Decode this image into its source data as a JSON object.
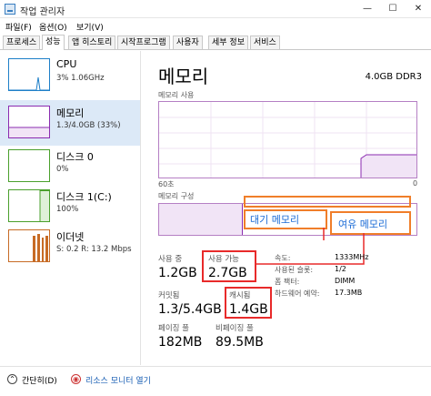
{
  "window": {
    "title": "작업 관리자",
    "minimize_glyph": "—",
    "maximize_glyph": "☐",
    "close_glyph": "✕"
  },
  "menu": [
    "파일(F)",
    "옵션(O)",
    "보기(V)"
  ],
  "tabs": [
    "프로세스",
    "성능",
    "앱 히스토리",
    "시작프로그램",
    "사용자",
    "세부 정보",
    "서비스"
  ],
  "sidebar": [
    {
      "name": "CPU",
      "sub1": "3% 1.06GHz",
      "sub2": "",
      "color": "#1e7fc8"
    },
    {
      "name": "메모리",
      "sub1": "1.3/4.0GB (33%)",
      "sub2": "",
      "color": "#8b2bb0"
    },
    {
      "name": "디스크 0",
      "sub1": "0%",
      "sub2": "",
      "color": "#4aa02c"
    },
    {
      "name": "디스크 1(C:)",
      "sub1": "100%",
      "sub2": "",
      "color": "#4aa02c"
    },
    {
      "name": "이더넷",
      "sub1": "S: 0.2 R: 13.2 Mbps",
      "sub2": "",
      "color": "#c76b25"
    }
  ],
  "memory": {
    "title": "메모리",
    "spec": "4.0GB DDR3",
    "usage_label": "메모리 사용",
    "time_label": "60초",
    "zero_label": "0",
    "composition_label": "메모리 구성",
    "stats": {
      "in_use_label": "사용 중",
      "in_use_value": "1.2GB",
      "available_label": "사용 가능",
      "available_value": "2.7GB",
      "committed_label": "커밋됨",
      "committed_value": "1.3/5.4GB",
      "cached_label": "캐시됨",
      "cached_value": "1.4GB",
      "paged_label": "페이징 풀",
      "paged_value": "182MB",
      "nonpaged_label": "비페이징 풀",
      "nonpaged_value": "89.5MB"
    },
    "details": [
      {
        "key": "속도:",
        "value": "1333MHz"
      },
      {
        "key": "사용된 슬롯:",
        "value": "1/2"
      },
      {
        "key": "폼 팩터:",
        "value": "DIMM"
      },
      {
        "key": "하드웨어 예약:",
        "value": "17.3MB"
      }
    ]
  },
  "annotations": {
    "standby": "대기 메모리",
    "free": "여유 메모리"
  },
  "footer": {
    "fewer_details": "간단히(D)",
    "resource_monitor": "리소스 모니터 열기"
  },
  "colors": {
    "memory_line": "#8b2bb0",
    "annotation_red": "#e82a2a",
    "annotation_orange": "#f07e2a",
    "selected_bg": "#dce9f7"
  }
}
